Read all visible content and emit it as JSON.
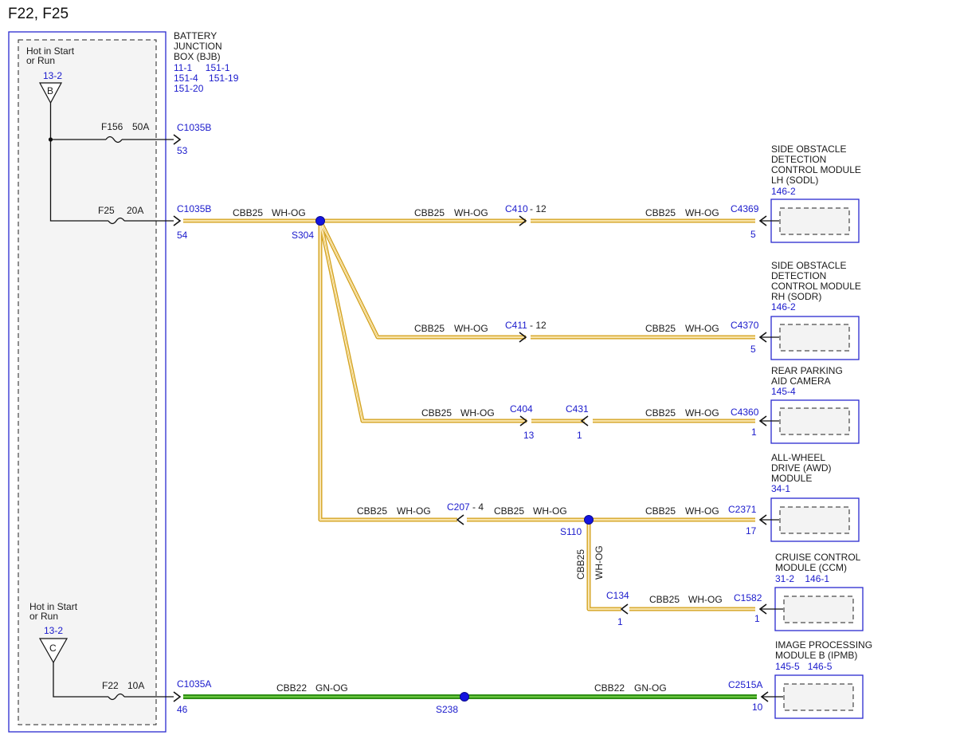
{
  "title": "F22, F25",
  "bjb": {
    "name_lines": [
      "BATTERY",
      "JUNCTION",
      "BOX (BJB)"
    ],
    "refs_line1": "11-1     151-1",
    "refs_line2": "151-4    151-19",
    "refs_line3": "151-20"
  },
  "feeds": [
    {
      "label_lines": [
        "Hot in Start",
        "or Run"
      ],
      "ref": "13-2",
      "letter": "B"
    },
    {
      "label_lines": [
        "Hot in Start",
        "or Run"
      ],
      "ref": "13-2",
      "letter": "C"
    }
  ],
  "fuses": [
    {
      "name": "F156",
      "rating": "50A",
      "connector": "C1035B",
      "pin": "53"
    },
    {
      "name": "F25",
      "rating": "20A",
      "connector": "C1035B",
      "pin": "54"
    },
    {
      "name": "F22",
      "rating": "10A",
      "connector": "C1035A",
      "pin": "46"
    }
  ],
  "splices": [
    "S304",
    "S110",
    "S238"
  ],
  "wire_labels": {
    "cbb25": "CBB25",
    "whog": "WH-OG",
    "cbb22": "CBB22",
    "gnog": "GN-OG"
  },
  "inline_connectors": {
    "c410": "C410",
    "c410_pin": "- 12",
    "c411": "C411",
    "c411_pin": "- 12",
    "c404": "C404",
    "c404_pin": "13",
    "c431": "C431",
    "c431_pin": "1",
    "c207": "C207",
    "c207_pin": "- 4",
    "c134": "C134",
    "c134_pin": "1"
  },
  "modules": [
    {
      "name_lines": [
        "SIDE OBSTACLE",
        "DETECTION",
        "CONTROL MODULE",
        "LH (SODL)"
      ],
      "ref": "146-2",
      "connector": "C4369",
      "pin": "5"
    },
    {
      "name_lines": [
        "SIDE OBSTACLE",
        "DETECTION",
        "CONTROL MODULE",
        "RH (SODR)"
      ],
      "ref": "146-2",
      "connector": "C4370",
      "pin": "5"
    },
    {
      "name_lines": [
        "REAR PARKING",
        "AID CAMERA"
      ],
      "ref": "145-4",
      "connector": "C4360",
      "pin": "1"
    },
    {
      "name_lines": [
        "ALL-WHEEL",
        "DRIVE (AWD)",
        "MODULE"
      ],
      "ref": "34-1",
      "connector": "C2371",
      "pin": "17"
    },
    {
      "name_lines": [
        "CRUISE CONTROL",
        "MODULE (CCM)"
      ],
      "ref": "31-2    146-1",
      "connector": "C1582",
      "pin": "1"
    },
    {
      "name_lines": [
        "IMAGE PROCESSING",
        "MODULE B (IPMB)"
      ],
      "ref": "145-5   146-5",
      "connector": "C2515A",
      "pin": "10"
    }
  ],
  "colors": {
    "connector_text": "#1a1acc",
    "box_outline": "#2a2ad0",
    "splice": "#1414e0",
    "wire_wh_og": "#d4a21c",
    "wire_gn_og": "#2f8f17"
  }
}
